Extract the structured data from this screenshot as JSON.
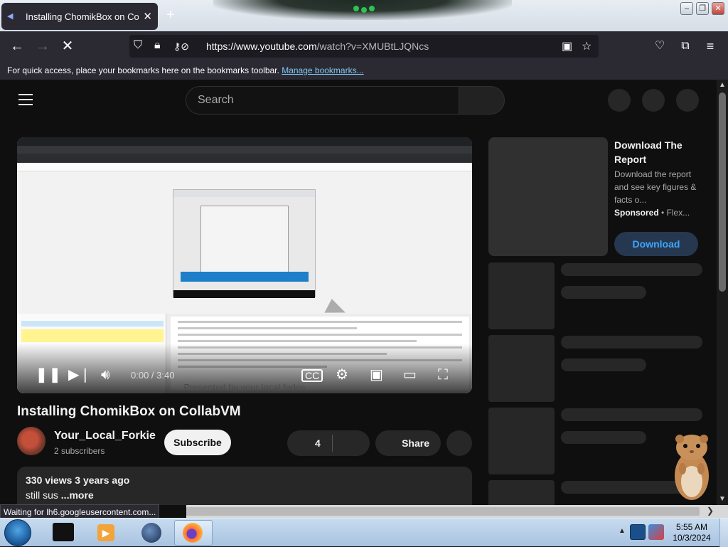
{
  "browser": {
    "tab_title": "Installing ChomikBox on Collab",
    "tab_close": "✕",
    "new_tab": "+",
    "url_scheme_host": "https://www.youtube.com",
    "url_path": "/watch?v=XMUBtLJQNcs",
    "bookmarks_hint": "For quick access, place your bookmarks here on the bookmarks toolbar.",
    "manage_bookmarks": "Manage bookmarks...",
    "status_text": "Waiting for lh6.googleusercontent.com..."
  },
  "youtube": {
    "search_placeholder": "Search",
    "video": {
      "time": "0:00 / 3:40",
      "caption": "Presented by your local forkie",
      "title": "Installing ChomikBox on CollabVM"
    },
    "channel": {
      "name": "Your_Local_Forkie",
      "subscribers": "2 subscribers",
      "subscribe_label": "Subscribe"
    },
    "actions": {
      "likes": "4",
      "share": "Share"
    },
    "description": {
      "meta": "330 views  3 years ago",
      "text": "still sus",
      "more": " ...more"
    },
    "ad": {
      "title": "Download The Report",
      "description": "Download the report and see key figures & facts o...",
      "sponsored": "Sponsored",
      "advertiser": " • Flex...",
      "button": "Download"
    }
  },
  "taskbar": {
    "time": "5:55 AM",
    "date": "10/3/2024"
  },
  "colors": {
    "background": "#0f0f0f",
    "accent_link": "#3ea6ff",
    "browser_chrome": "#2b2a33"
  },
  "icons": [
    "back-arrow-icon",
    "forward-arrow-icon",
    "stop-icon",
    "shield-icon",
    "lock-icon",
    "permissions-icon",
    "reader-view-icon",
    "bookmark-star-icon",
    "pocket-icon",
    "extensions-icon",
    "menu-icon",
    "play-pause-icon",
    "next-icon",
    "volume-icon",
    "captions-icon",
    "settings-gear-icon",
    "miniplayer-icon",
    "theater-icon",
    "fullscreen-icon"
  ]
}
